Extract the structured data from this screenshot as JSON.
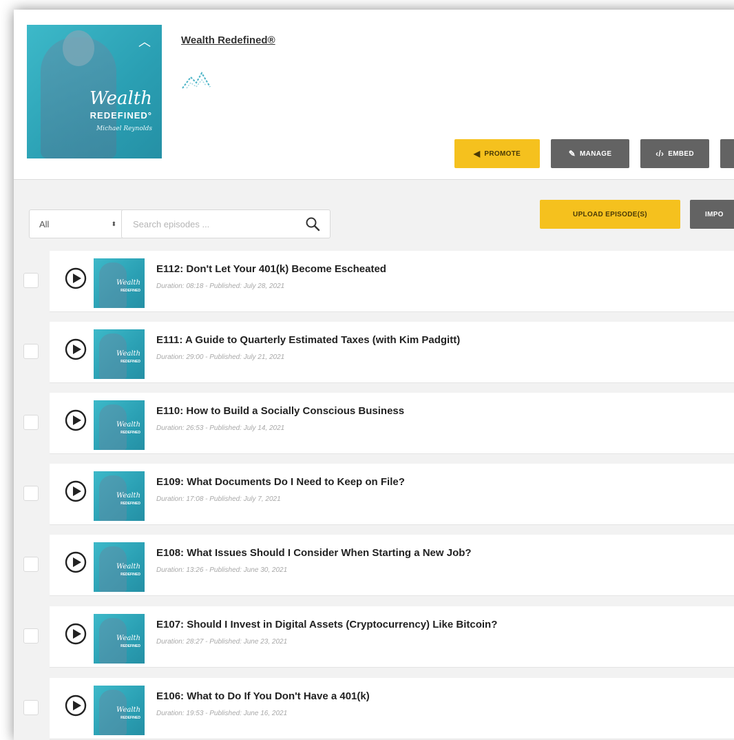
{
  "podcast": {
    "title": "Wealth Redefined®",
    "cover": {
      "wordmark": "Wealth",
      "subtitle": "REDEFINED°",
      "author": "Michael Reynolds"
    }
  },
  "actions": [
    {
      "label": "PROMOTE",
      "icon": "megaphone-icon",
      "style": "yellow"
    },
    {
      "label": "MANAGE",
      "icon": "pencil-icon",
      "style": "gray"
    },
    {
      "label": "EMBED",
      "icon": "code-icon",
      "style": "gray"
    }
  ],
  "filter": {
    "selected": "All"
  },
  "search": {
    "placeholder": "Search episodes ..."
  },
  "toolbar": {
    "upload_label": "UPLOAD EPISODE(S)",
    "import_label": "IMPO"
  },
  "episodes": [
    {
      "title": "E112: Don't Let Your 401(k) Become Escheated",
      "meta": "Duration: 08:18 - Published: July 28, 2021"
    },
    {
      "title": "E111: A Guide to Quarterly Estimated Taxes (with Kim Padgitt)",
      "meta": "Duration: 29:00 - Published: July 21, 2021"
    },
    {
      "title": "E110: How to Build a Socially Conscious Business",
      "meta": "Duration: 26:53 - Published: July 14, 2021"
    },
    {
      "title": "E109: What Documents Do I Need to Keep on File?",
      "meta": "Duration: 17:08 - Published: July 7, 2021"
    },
    {
      "title": "E108: What Issues Should I Consider When Starting a New Job?",
      "meta": "Duration: 13:26 - Published: June 30, 2021"
    },
    {
      "title": "E107: Should I Invest in Digital Assets (Cryptocurrency) Like Bitcoin?",
      "meta": "Duration: 28:27 - Published: June 23, 2021"
    },
    {
      "title": "E106: What to Do If You Don't Have a 401(k)",
      "meta": "Duration: 19:53 - Published: June 16, 2021"
    }
  ],
  "colors": {
    "accent_yellow": "#f5c11e",
    "button_gray": "#636363",
    "cover_teal": "#2fa9bd"
  }
}
